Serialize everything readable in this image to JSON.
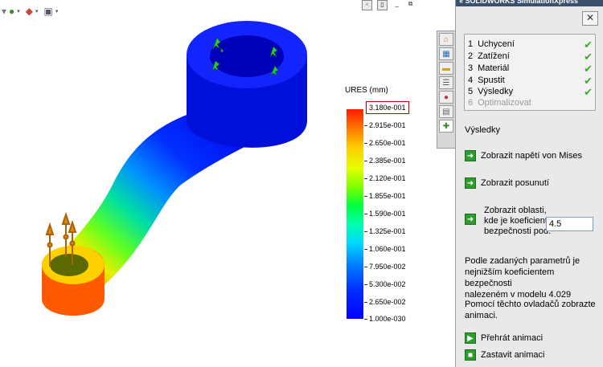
{
  "viewport": {
    "toolbar": {
      "icons": [
        "display-style-icon",
        "view-orientation-icon",
        "scene-icon"
      ]
    },
    "window_controls": [
      "restore-viewport-icon",
      "split-icon",
      "minimize-icon",
      "maximize-icon"
    ]
  },
  "legend": {
    "title": "URES (mm)",
    "ticks": [
      "3.180e-001",
      "2.915e-001",
      "2.650e-001",
      "2.385e-001",
      "2.120e-001",
      "1.855e-001",
      "1.590e-001",
      "1.325e-001",
      "1.060e-001",
      "7.950e-002",
      "5.300e-002",
      "2.650e-002",
      "1.000e-030"
    ],
    "highlight_color": "#c00000"
  },
  "tabs": [
    "home-tab-icon",
    "study-tab-icon",
    "folder-tab-icon",
    "options-tab-icon",
    "appearance-tab-icon",
    "clipboard-tab-icon",
    "simulationxpress-tab-icon"
  ],
  "pane": {
    "title": "« SOLIDWORKS SimulationXpress",
    "close": "✕",
    "steps": [
      {
        "num": "1",
        "label": "Uchycení",
        "done": true
      },
      {
        "num": "2",
        "label": "Zatížení",
        "done": true
      },
      {
        "num": "3",
        "label": "Materiál",
        "done": true
      },
      {
        "num": "4",
        "label": "Spustit",
        "done": true
      },
      {
        "num": "5",
        "label": "Výsledky",
        "done": true
      },
      {
        "num": "6",
        "label": "Optimalizovat",
        "done": false
      }
    ],
    "check": "✔",
    "results_heading": "Výsledky",
    "show_von_mises": "Zobrazit napětí von Mises",
    "show_displacement": "Zobrazit posunutí",
    "fos_line1": "Zobrazit oblasti,",
    "fos_line2": "kde je koeficient",
    "fos_line3": "bezpečnosti pod:",
    "fos_value": "4.5",
    "note_line1": "Podle zadaných parametrů je",
    "note_line2": "nejnižším koeficientem bezpečnosti",
    "note_line3": "nalezeném v modelu 4.029",
    "anim_line1": "Pomocí těchto ovladačů zobrazte",
    "anim_line2": "animaci.",
    "play": "Přehrát animaci",
    "stop": "Zastavit animaci",
    "arrow_glyph": "➜",
    "play_glyph": "▶",
    "stop_glyph": "■"
  }
}
